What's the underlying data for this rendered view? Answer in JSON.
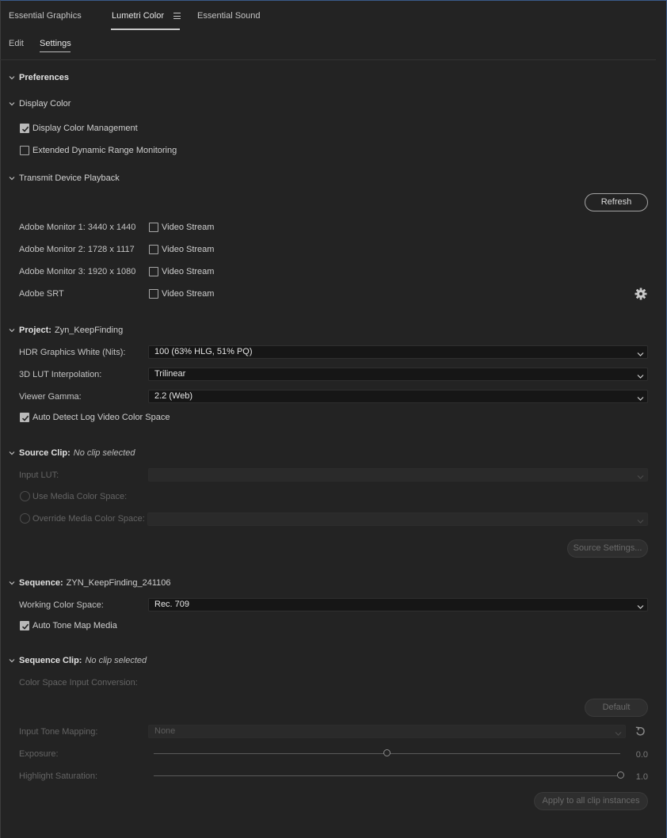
{
  "tabs": [
    {
      "label": "Essential Graphics"
    },
    {
      "label": "Lumetri Color"
    },
    {
      "label": "Essential Sound"
    }
  ],
  "subtabs": [
    {
      "label": "Edit"
    },
    {
      "label": "Settings"
    }
  ],
  "preferences": {
    "title": "Preferences"
  },
  "display_color": {
    "title": "Display Color",
    "management_label": "Display Color Management",
    "management_checked": true,
    "edr_label": "Extended Dynamic Range Monitoring",
    "edr_checked": false
  },
  "transmit": {
    "title": "Transmit Device Playback",
    "refresh_label": "Refresh",
    "devices": [
      {
        "name": "Adobe Monitor 1: 3440 x 1440",
        "stream_label": "Video Stream",
        "checked": false
      },
      {
        "name": "Adobe Monitor 2: 1728 x 1117",
        "stream_label": "Video Stream",
        "checked": false
      },
      {
        "name": "Adobe Monitor 3: 1920 x 1080",
        "stream_label": "Video Stream",
        "checked": false
      },
      {
        "name": "Adobe SRT",
        "stream_label": "Video Stream",
        "checked": false
      }
    ],
    "settings_icon": "gear-icon"
  },
  "project": {
    "title": "Project:",
    "name": "Zyn_KeepFinding",
    "hdr_label": "HDR Graphics White (Nits):",
    "hdr_value": "100 (63% HLG, 51% PQ)",
    "lut_label": "3D LUT Interpolation:",
    "lut_value": "Trilinear",
    "gamma_label": "Viewer Gamma:",
    "gamma_value": "2.2 (Web)",
    "auto_detect_label": "Auto Detect Log Video Color Space",
    "auto_detect_checked": true
  },
  "source_clip": {
    "title": "Source Clip:",
    "value": "No clip selected",
    "input_lut_label": "Input LUT:",
    "use_media_label": "Use Media Color Space:",
    "override_label": "Override Media Color Space:",
    "settings_button": "Source Settings..."
  },
  "sequence": {
    "title": "Sequence:",
    "name": "ZYN_KeepFinding_241106",
    "working_label": "Working Color Space:",
    "working_value": "Rec. 709",
    "tone_map_label": "Auto Tone Map Media",
    "tone_map_checked": true
  },
  "sequence_clip": {
    "title": "Sequence Clip:",
    "value": "No clip selected",
    "conversion_label": "Color Space Input Conversion:",
    "default_button": "Default",
    "tone_mapping_label": "Input Tone Mapping:",
    "tone_mapping_value": "None",
    "exposure_label": "Exposure:",
    "exposure_value": "0.0",
    "exposure_level": 0.5,
    "highlight_label": "Highlight Saturation:",
    "highlight_value": "1.0",
    "highlight_level": 1.0,
    "apply_button": "Apply to all clip instances"
  }
}
